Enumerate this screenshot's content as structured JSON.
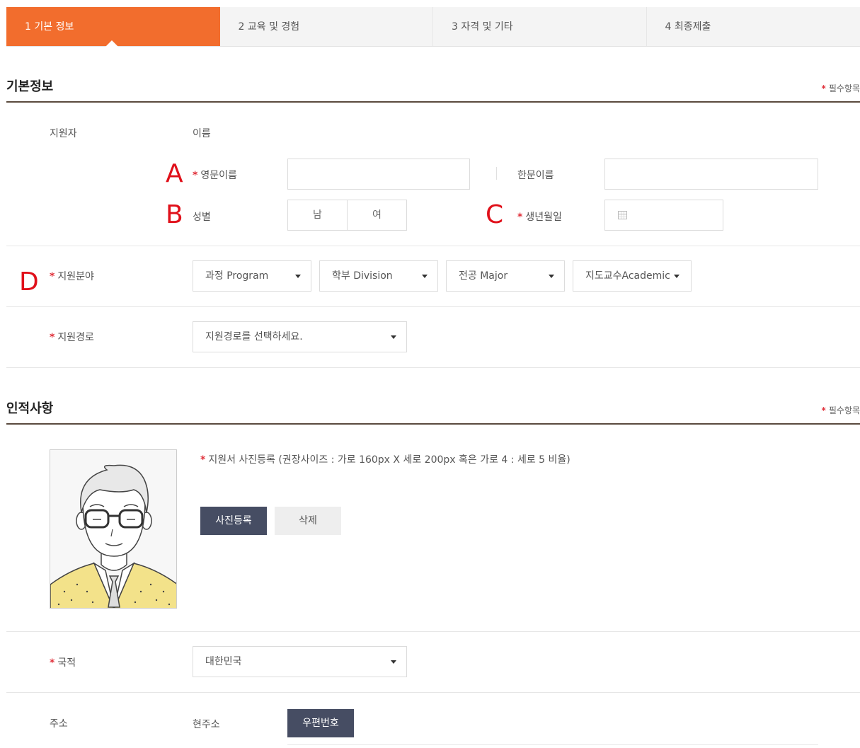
{
  "steps": [
    {
      "label": "1  기본 정보"
    },
    {
      "label": "2  교육 및 경험"
    },
    {
      "label": "3  자격 및 기타"
    },
    {
      "label": "4  최종제출"
    }
  ],
  "sections": {
    "basic": {
      "title": "기본정보",
      "required_note": "필수항목"
    },
    "personal": {
      "title": "인적사항",
      "required_note": "필수항목"
    }
  },
  "required_star": "*",
  "applicant": {
    "label": "지원자",
    "name_label": "이름",
    "eng_name_label": "영문이름",
    "eng_name_value": "",
    "hanja_name_label": "한문이름",
    "hanja_name_value": "",
    "gender_label": "성별",
    "gender_options": [
      "남",
      "여"
    ],
    "birth_label": "생년월일",
    "birth_value": ""
  },
  "field": {
    "label": "지원분야",
    "selects": [
      "과정 Program",
      "학부 Division",
      "전공 Major",
      "지도교수Academic"
    ]
  },
  "route": {
    "label": "지원경로",
    "selected": "지원경로를 선택하세요."
  },
  "photo": {
    "note": "지원서 사진등록 (권장사이즈 : 가로 160px X 세로 200px 혹은 가로 4 : 세로 5 비율)",
    "upload_label": "사진등록",
    "delete_label": "삭제"
  },
  "nationality": {
    "label": "국적",
    "selected": "대한민국"
  },
  "address": {
    "label": "주소",
    "current_label": "현주소",
    "zip_button": "우편번호"
  },
  "markers": [
    "A",
    "B",
    "C",
    "D"
  ],
  "colors": {
    "accent": "#f26d2d",
    "required": "#e0303a",
    "marker": "#e0101a",
    "dark_button": "#464d63"
  }
}
